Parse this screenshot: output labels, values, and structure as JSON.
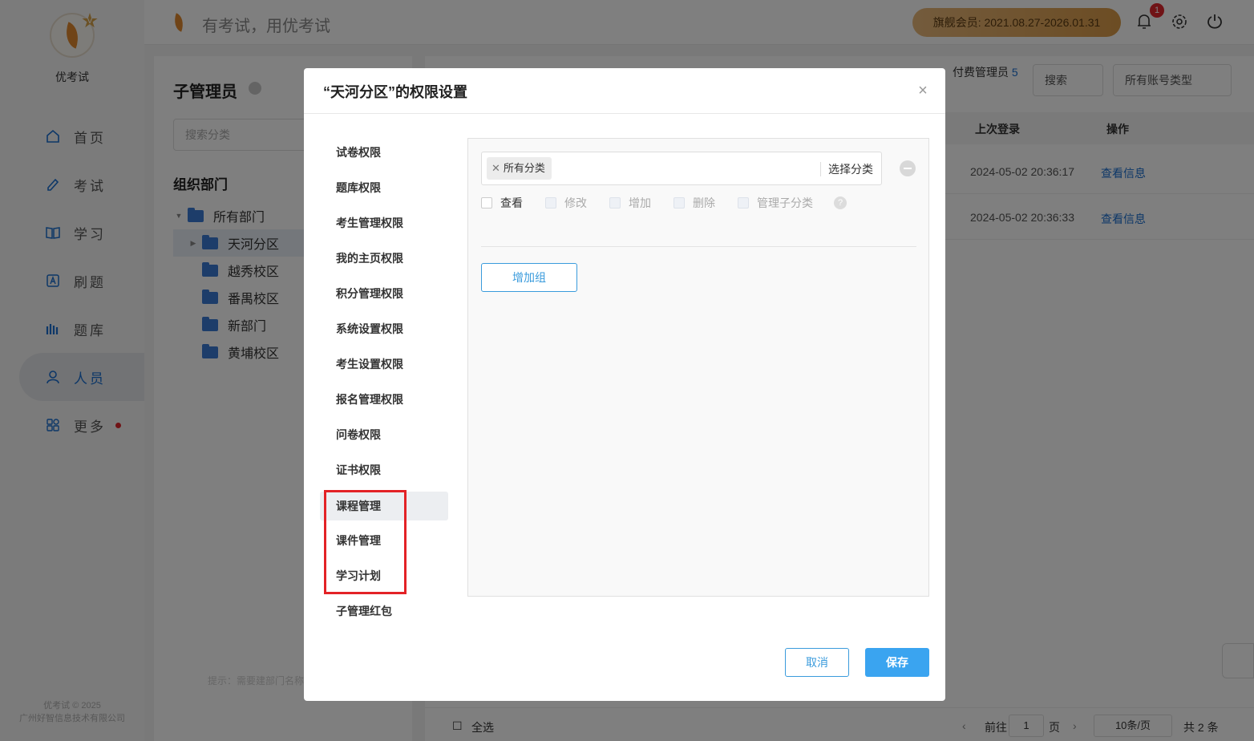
{
  "app": {
    "logo_text": "优考试",
    "slogan": "有考试，用优考试",
    "member_badge": "旗舰会员: 2021.08.27-2026.01.31",
    "notification_count": "1",
    "copyright_line1": "优考试 © 2025",
    "copyright_line2": "广州好智信息技术有限公司"
  },
  "nav": {
    "items": [
      {
        "label": "首页",
        "icon": "home-icon"
      },
      {
        "label": "考试",
        "icon": "exam-icon"
      },
      {
        "label": "学习",
        "icon": "book-icon"
      },
      {
        "label": "刷题",
        "icon": "practice-icon"
      },
      {
        "label": "题库",
        "icon": "library-icon"
      },
      {
        "label": "人员",
        "icon": "person-icon"
      },
      {
        "label": "更多",
        "icon": "more-icon"
      }
    ]
  },
  "left_panel": {
    "title": "子管理员",
    "search_placeholder": "搜索分类",
    "org_title": "组织部门",
    "tree": [
      "所有部门",
      "天河分区",
      "越秀校区",
      "番禺校区",
      "新部门",
      "黄埔校区"
    ],
    "tip": "提示：需要建部门名称，请单击右键"
  },
  "main_panel": {
    "stats_label": "付费管理员",
    "stats_count": "5",
    "search_label": "搜索",
    "account_type": "所有账号类型",
    "col_last_login": "上次登录",
    "col_action": "操作",
    "rows": [
      {
        "last_login": "2024-05-02 20:36:17",
        "action": "查看信息"
      },
      {
        "last_login": "2024-05-02 20:36:33",
        "action": "查看信息"
      }
    ],
    "footer": {
      "select_all": "全选",
      "goto": "前往",
      "page": "1",
      "page_unit": "页",
      "page_size": "10条/页",
      "total": "共 2 条"
    }
  },
  "dialog": {
    "title": "“天河分区”的权限设置",
    "menu": [
      "试卷权限",
      "题库权限",
      "考生管理权限",
      "我的主页权限",
      "积分管理权限",
      "系统设置权限",
      "考生设置权限",
      "报名管理权限",
      "问卷权限",
      "证书权限",
      "课程管理",
      "课件管理",
      "学习计划",
      "子管理红包"
    ],
    "active_menu": "课程管理",
    "category_tag": "所有分类",
    "select_category": "选择分类",
    "checks": [
      {
        "label": "查看",
        "disabled": false
      },
      {
        "label": "修改",
        "disabled": true
      },
      {
        "label": "增加",
        "disabled": true
      },
      {
        "label": "删除",
        "disabled": true
      },
      {
        "label": "管理子分类",
        "disabled": true
      }
    ],
    "add_group": "增加组",
    "cancel": "取消",
    "save": "保存"
  },
  "colors": {
    "accent": "#1a6fd0",
    "button_blue": "#3aa4f0",
    "highlight_red": "#e32226",
    "member_gold": "#d99a48"
  }
}
